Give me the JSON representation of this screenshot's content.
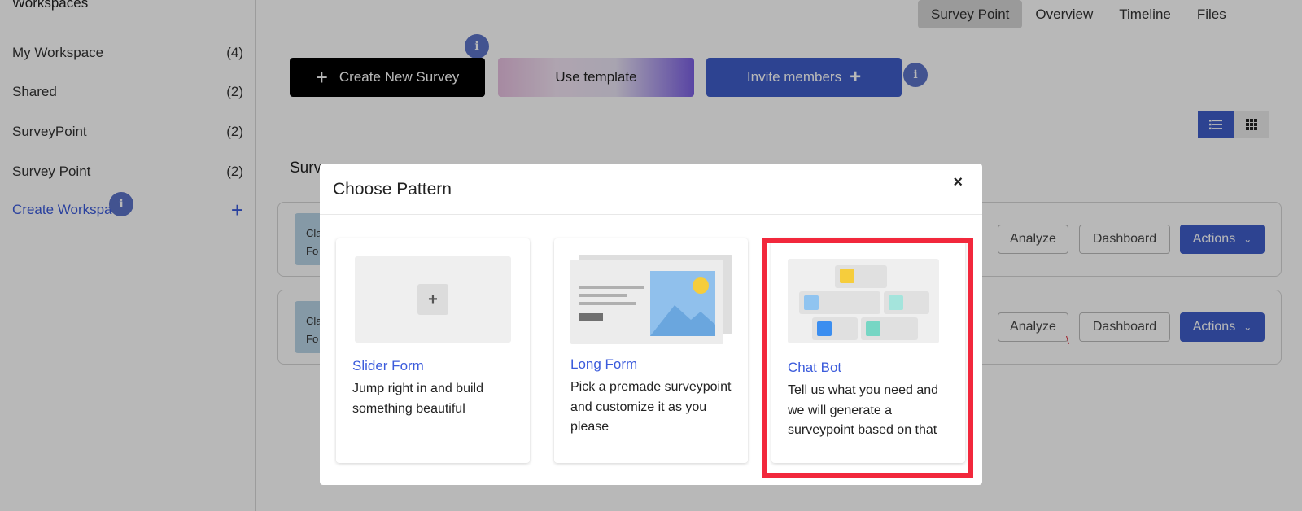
{
  "sidebar": {
    "title": "Workspaces",
    "items": [
      {
        "label": "My Workspace",
        "count": "(4)"
      },
      {
        "label": "Shared",
        "count": "(2)"
      },
      {
        "label": "SurveyPoint",
        "count": "(2)"
      },
      {
        "label": "Survey Point",
        "count": "(2)"
      }
    ],
    "create_label": "Create Workspace",
    "create_icon": "plus-icon"
  },
  "tabs": [
    "Survey Point",
    "Overview",
    "Timeline",
    "Files"
  ],
  "active_tab": "Survey Point",
  "toolbar": {
    "create_label": "Create New Survey",
    "template_label": "Use template",
    "invite_label": "Invite members"
  },
  "info_glyph": "i",
  "section_label": "Surv",
  "rows": [
    {
      "thumb": [
        "Cla",
        "Fo"
      ],
      "analyze": "Analyze",
      "dashboard": "Dashboard",
      "actions": "Actions"
    },
    {
      "thumb": [
        "Cla",
        "Fo"
      ],
      "analyze": "Analyze",
      "dashboard": "Dashboard",
      "actions": "Actions"
    }
  ],
  "modal": {
    "title": "Choose Pattern",
    "close": "×",
    "cards": [
      {
        "title": "Slider Form",
        "description": "Jump right in and build something beautiful"
      },
      {
        "title": "Long Form",
        "description": "Pick a premade surveypoint and customize it as you please"
      },
      {
        "title": "Chat Bot",
        "description": "Tell us what you need and we will generate a surveypoint based on that"
      }
    ]
  },
  "colors": {
    "accent": "#3f5ec9",
    "link": "#3b5bdb",
    "highlight": "#f2283c"
  },
  "annotation_mark": "\\"
}
